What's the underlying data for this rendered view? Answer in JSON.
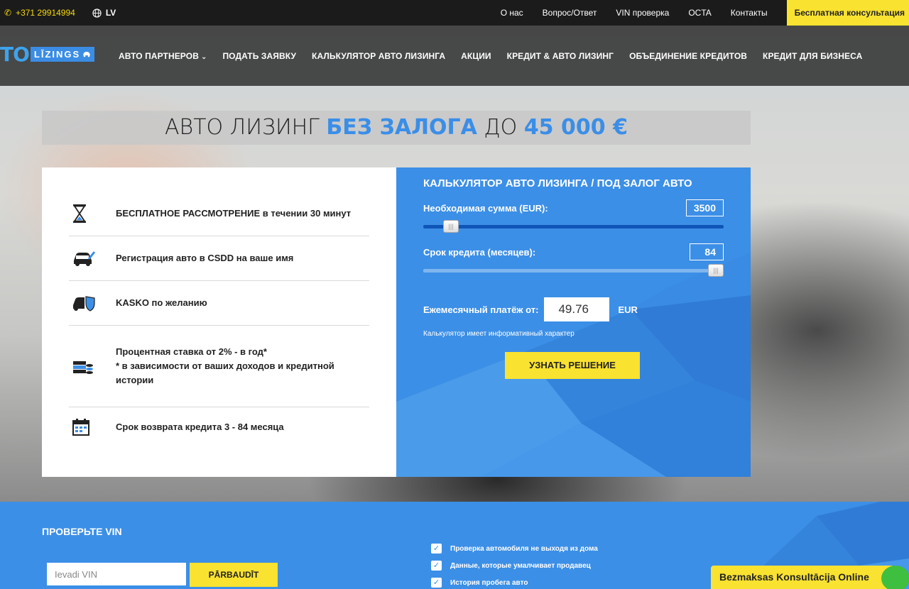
{
  "topbar": {
    "phone": "+371 29914994",
    "lang": "LV",
    "links": [
      "О нас",
      "Вопрос/Ответ",
      "VIN проверка",
      "OCTA",
      "Контакты"
    ],
    "consult": "Бесплатная консультация"
  },
  "logo": {
    "prefix": "TO",
    "name": "LĪZINGS"
  },
  "nav": [
    {
      "label": "АВТО ПАРТНЕРОВ"
    },
    {
      "label": "ПОДАТЬ ЗАЯВКУ"
    },
    {
      "label": "КАЛЬКУЛЯТОР АВТО ЛИЗИНГА"
    },
    {
      "label": "АКЦИИ"
    },
    {
      "label": "КРЕДИТ & АВТО ЛИЗИНГ"
    },
    {
      "label": "ОБЪЕДИНЕНИЕ КРЕДИТОВ"
    },
    {
      "label": "КРЕДИТ ДЛЯ БИЗНЕСА"
    }
  ],
  "headline": {
    "part1": "АВТО ЛИЗИНГ ",
    "part2": "БЕЗ ЗАЛОГА",
    "part3": " ДО ",
    "part4": "45 000 €"
  },
  "features": [
    {
      "icon": "hourglass-icon",
      "text": "БЕСПЛАТНОЕ РАССМОТРЕНИЕ в течении 30 минут"
    },
    {
      "icon": "car-registration-icon",
      "text": "Регистрация авто в CSDD на ваше имя"
    },
    {
      "icon": "car-shield-icon",
      "text": "KASKO по желанию"
    },
    {
      "icon": "money-stack-icon",
      "text": "Процентная ставка от 2% - в год*",
      "text2": "* в зависимости от ваших доходов и кредитной истории"
    },
    {
      "icon": "calendar-icon",
      "text": "Срок возврата кредита 3 - 84 месяца"
    }
  ],
  "calculator": {
    "title": "КАЛЬКУЛЯТОР АВТО ЛИЗИНГА / ПОД ЗАЛОГ АВТО",
    "amount_label": "Необходимая сумма (EUR):",
    "amount_value": "3500",
    "amount_fraction": 0.07,
    "term_label": "Срок кредита (месяцев):",
    "term_value": "84",
    "term_fraction": 1.0,
    "monthly_label": "Ежемесячный платёж от:",
    "monthly_value": "49.76",
    "currency": "EUR",
    "note": "Калькулятор имеет информативный характер",
    "cta": "УЗНАТЬ РЕШЕНИЕ"
  },
  "vin": {
    "title": "ПРОВЕРЬТЕ VIN",
    "placeholder": "Ievadi VIN",
    "button": "PĀRBAUDĪT",
    "checks": [
      "Проверка автомобиля не выходя из дома",
      "Данные, которые умалчивает продавец",
      "История пробега авто"
    ]
  },
  "chat": {
    "label": "Bezmaksas Konsultācija Online"
  },
  "colors": {
    "accent": "#3c8fe6",
    "cta": "#f9e230",
    "topbar": "#1b1b1b"
  }
}
